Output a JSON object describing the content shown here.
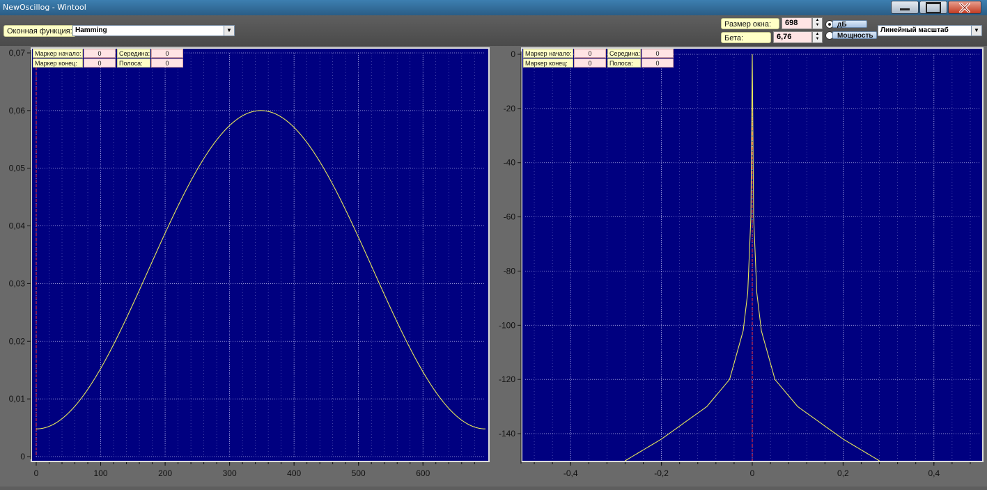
{
  "window": {
    "title": "NewOscillog - Wintool"
  },
  "toolbar": {
    "window_function_label": "Оконная функция:",
    "window_function_value": "Hamming",
    "window_size_label": "Размер окна:",
    "window_size_value": "698",
    "beta_label": "Бета:",
    "beta_value": "6,76",
    "radio_db_label": "дБ",
    "radio_power_label": "Мощность",
    "selected_radio": "дБ",
    "scale_value": "Линейный масштаб"
  },
  "markers": {
    "start_label": "Маркер начало:",
    "end_label": "Маркер конец:",
    "middle_label": "Середина:",
    "band_label": "Полоса:",
    "left": {
      "start": "0",
      "end": "0",
      "middle": "0",
      "band": "0"
    },
    "right": {
      "start": "0",
      "end": "0",
      "middle": "0",
      "band": "0"
    }
  },
  "colors": {
    "plot_bg": "#000080",
    "curve": "#e6e65a",
    "grid": "#c8c8ff",
    "marker": "#ff3030"
  },
  "chart_data": [
    {
      "type": "line",
      "title": "",
      "xlabel": "",
      "ylabel": "",
      "xlim": [
        0,
        697
      ],
      "ylim": [
        0,
        0.07
      ],
      "x_ticks": [
        0,
        100,
        200,
        300,
        400,
        500,
        600
      ],
      "x_tick_labels": [
        "0",
        "100",
        "200",
        "300",
        "400",
        "500",
        "600"
      ],
      "y_ticks": [
        0,
        0.01,
        0.02,
        0.03,
        0.04,
        0.05,
        0.06,
        0.07
      ],
      "y_tick_labels": [
        "0",
        "0,01",
        "0,02",
        "0,03",
        "0,04",
        "0,05",
        "0,06",
        "0,07"
      ],
      "grid": true,
      "series": [
        {
          "function": "hamming",
          "n": 698,
          "peak": 0.06,
          "min": 0.0048,
          "x": [
            0,
            50,
            100,
            150,
            200,
            250,
            300,
            348,
            400,
            450,
            500,
            550,
            600,
            650,
            697
          ],
          "values": [
            0.0048,
            0.0079,
            0.0166,
            0.0294,
            0.043,
            0.0521,
            0.058,
            0.06,
            0.0573,
            0.0505,
            0.0411,
            0.0283,
            0.0154,
            0.0074,
            0.0048
          ]
        }
      ],
      "marker_x": 0
    },
    {
      "type": "line",
      "title": "",
      "xlabel": "",
      "ylabel": "",
      "xlim": [
        -0.5,
        0.5
      ],
      "ylim": [
        -150,
        0
      ],
      "x_ticks": [
        -0.4,
        -0.2,
        0,
        0.2,
        0.4
      ],
      "x_tick_labels": [
        "-0,4",
        "-0,2",
        "0",
        "0,2",
        "0,4"
      ],
      "y_ticks": [
        0,
        -20,
        -40,
        -60,
        -80,
        -100,
        -120,
        -140
      ],
      "y_tick_labels": [
        "0",
        "-20",
        "-40",
        "-60",
        "-80",
        "-100",
        "-120",
        "-140"
      ],
      "grid": true,
      "series": [
        {
          "x": [
            -0.28,
            -0.2,
            -0.1,
            -0.05,
            -0.02,
            -0.01,
            -0.003,
            0,
            0.003,
            0.01,
            0.02,
            0.05,
            0.1,
            0.2,
            0.28
          ],
          "values": [
            -150,
            -142,
            -130,
            -120,
            -102,
            -88,
            -60,
            0,
            -60,
            -88,
            -102,
            -120,
            -130,
            -142,
            -150
          ]
        }
      ],
      "marker_x": 0
    }
  ]
}
